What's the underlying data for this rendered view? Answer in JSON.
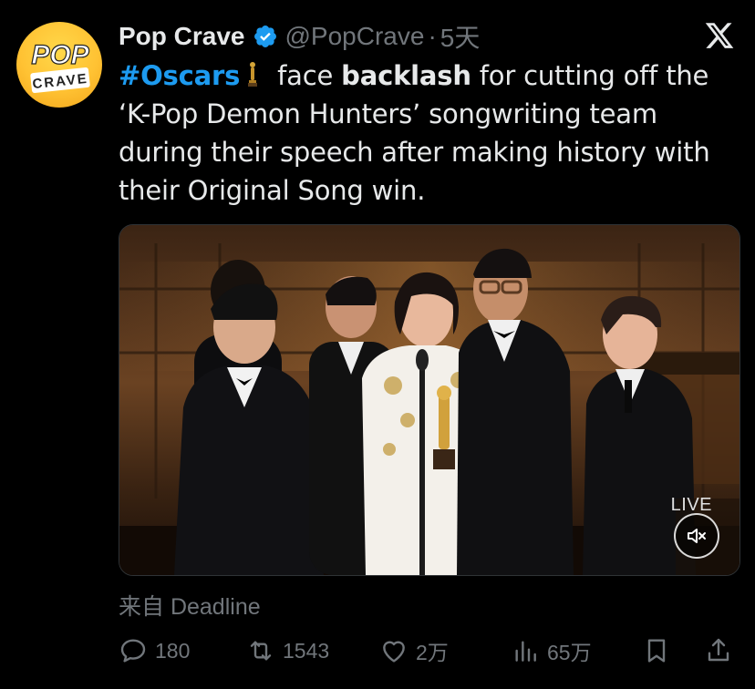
{
  "tweet": {
    "display_name": "Pop Crave",
    "handle": "@PopCrave",
    "separator": "·",
    "time": "5天",
    "text": {
      "hashtag": "#Oscars",
      "part1": " face ",
      "bold": "backlash",
      "part2": " for cutting off the ‘K-Pop Demon Hunters’ songwriting team during their speech after making history with their Original Song win."
    },
    "source": "来自 Deadline"
  },
  "avatar": {
    "text_top": "POP",
    "text_bottom": "CRAVE"
  },
  "media": {
    "badge": "LIVE",
    "mute_icon": "speaker-muted-icon"
  },
  "actions": {
    "replies": "180",
    "retweets": "1543",
    "likes": "2万",
    "views": "65万"
  },
  "colors": {
    "accent": "#1d9bf0",
    "muted": "#71767b",
    "text": "#e7e9ea",
    "background": "#000000",
    "avatar": "#ffc233"
  }
}
